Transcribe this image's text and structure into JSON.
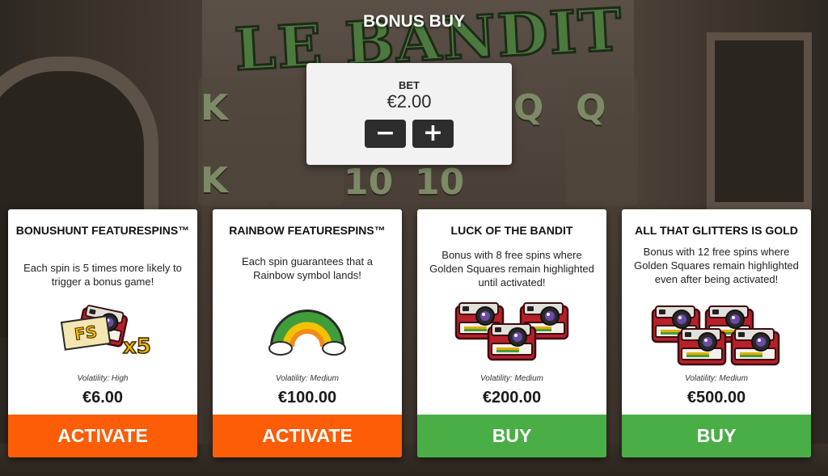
{
  "game": {
    "logo_text": "LE BANDIT",
    "reel_symbols": [
      "K",
      "K",
      "10",
      "10",
      "Q",
      "Q"
    ]
  },
  "header": {
    "title": "BONUS BUY"
  },
  "bet": {
    "label": "BET",
    "value": "€2.00",
    "decrease_label": "−",
    "increase_label": "+"
  },
  "cards": [
    {
      "title": "BONUSHUNT FEATURESPINS™",
      "description": "Each spin is 5 times more likely to trigger a bonus game!",
      "art": "fs-x5-camera-icon",
      "art_text": "FS x5",
      "volatility": "Volatility: High",
      "price": "€6.00",
      "action": "ACTIVATE",
      "action_color": "#fc5d06"
    },
    {
      "title": "RAINBOW FEATURESPINS™",
      "description": "Each spin guarantees that a Rainbow symbol lands!",
      "art": "rainbow-icon",
      "volatility": "Volatility: Medium",
      "price": "€100.00",
      "action": "ACTIVATE",
      "action_color": "#fc5d06"
    },
    {
      "title": "LUCK OF THE BANDIT",
      "description": "Bonus with 8 free spins where Golden Squares remain highlighted until activated!",
      "art": "three-cameras-icon",
      "volatility": "Volatility: Medium",
      "price": "€200.00",
      "action": "BUY",
      "action_color": "#4aae47"
    },
    {
      "title": "ALL THAT GLITTERS IS GOLD",
      "description": "Bonus with 12 free spins where Golden Squares remain highlighted even after being activated!",
      "art": "four-cameras-icon",
      "volatility": "Volatility: Medium",
      "price": "€500.00",
      "action": "BUY",
      "action_color": "#4aae47"
    }
  ]
}
